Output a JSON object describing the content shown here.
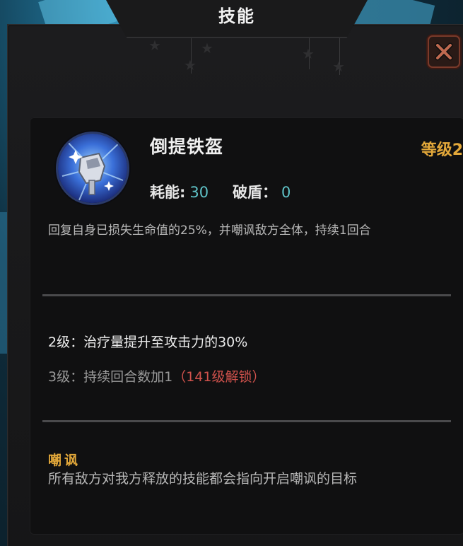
{
  "window": {
    "title": "技能"
  },
  "close_button": {
    "icon": "close-icon"
  },
  "skill": {
    "icon": "iron-helmet-icon",
    "name": "倒提铁盔",
    "level": "等级2",
    "cost_label": "耗能:",
    "cost_value": "30",
    "break_label": "破盾：",
    "break_value": "0",
    "description": "回复自身已损失生命值的25%，并嘲讽敌方全体，持续1回合"
  },
  "upgrades": [
    {
      "text": "2级：治疗量提升至攻击力的30%",
      "unlock": ""
    },
    {
      "text": "3级：持续回合数加1",
      "unlock": "（141级解锁）"
    }
  ],
  "keyword": {
    "title": "嘲讽",
    "description": "所有敌方对我方释放的技能都会指向开启嘲讽的目标"
  },
  "colors": {
    "accent_gold": "#e3a83a",
    "value_teal": "#5fc2c7",
    "locked_red": "#d0524c"
  }
}
